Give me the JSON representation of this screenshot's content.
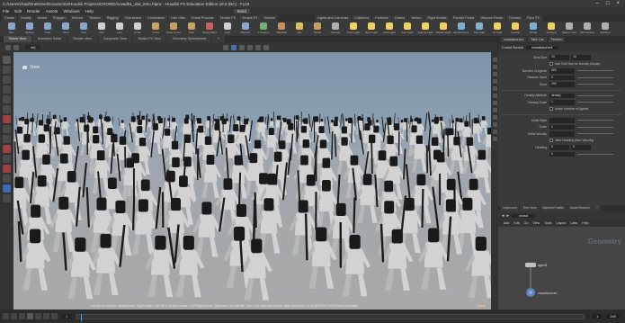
{
  "window": {
    "title": "C:/Users/chad/OneDrive/Documents/Houdini Projects/CROWD/crowd01_sbd_intro.hipnc - Houdini FX Education Edition 18.0 (NC) - Fy18"
  },
  "menu": {
    "items": [
      "File",
      "Edit",
      "Render",
      "Assets",
      "Windows",
      "Help",
      "Help"
    ],
    "desktop": "Build"
  },
  "shelf": {
    "tabs_left": [
      "Create",
      "Modify",
      "Model",
      "Polygon",
      "Deform",
      "Texture",
      "Rigging",
      "Characters",
      "Constraints",
      "Hair Utils",
      "Guide Process",
      "Terrain FX",
      "Simple FX",
      "Volume"
    ],
    "tabs_right": [
      "Lights and Cameras",
      "Collisions",
      "Particles",
      "Grains",
      "Vellum",
      "Rigid Bodies",
      "Particle Fluids",
      "Viscous Fluids",
      "Oceans",
      "Pyro FX"
    ],
    "tools": [
      {
        "label": "Box",
        "color": "#8aa6c8"
      },
      {
        "label": "Sphere",
        "color": "#8aa6c8"
      },
      {
        "label": "Tube",
        "color": "#8aa6c8"
      },
      {
        "label": "Torus",
        "color": "#8aa6c8"
      },
      {
        "label": "Grid",
        "color": "#8aa6c8"
      },
      {
        "label": "Null",
        "color": "#d0d0d0"
      },
      {
        "label": "Line",
        "color": "#d0d0d0"
      },
      {
        "label": "Circle",
        "color": "#d0d0d0"
      },
      {
        "label": "Curve",
        "color": "#c8a060"
      },
      {
        "label": "Draw Curve",
        "color": "#c8a060"
      },
      {
        "label": "Path",
        "color": "#c8a060"
      },
      {
        "label": "Spray Paint",
        "color": "#c86060"
      },
      {
        "label": "Font",
        "color": "#d0d0d0"
      },
      {
        "label": "Platonic",
        "color": "#8aa6c8"
      },
      {
        "label": "L-System",
        "color": "#70b070"
      },
      {
        "label": "Metaball",
        "color": "#c89060"
      },
      {
        "label": "File",
        "color": "#d8c060"
      },
      {
        "label": "Spiral",
        "color": "#c8a060"
      },
      {
        "label": "Camera",
        "color": "#b0b0b0"
      },
      {
        "label": "Point Light",
        "color": "#f0d060"
      },
      {
        "label": "Spot Light",
        "color": "#f0d060"
      },
      {
        "label": "Area Light",
        "color": "#f0d060"
      },
      {
        "label": "Geo Light",
        "color": "#f0d060"
      },
      {
        "label": "Volume Light",
        "color": "#f0d060"
      },
      {
        "label": "Distant Light",
        "color": "#f0d060"
      },
      {
        "label": "Environment",
        "color": "#80b0d0"
      },
      {
        "label": "Sky Light",
        "color": "#80b0d0"
      },
      {
        "label": "GI Light",
        "color": "#f0d060"
      },
      {
        "label": "Caustic",
        "color": "#f0d060"
      },
      {
        "label": "Portal",
        "color": "#80b0d0"
      },
      {
        "label": "Ambient",
        "color": "#f0d060"
      },
      {
        "label": "Stereo Cam",
        "color": "#b0b0b0"
      },
      {
        "label": "VR Camera",
        "color": "#b0b0b0"
      },
      {
        "label": "Switcher",
        "color": "#b0b0b0"
      }
    ]
  },
  "panes": {
    "tabs": [
      "Scene View",
      "Animation Editor",
      "Render View",
      "Composite View",
      "Motion FX View",
      "Geometry Spreadsheet",
      "+"
    ],
    "active": 0
  },
  "viewport": {
    "path": "obj",
    "label": "View",
    "help_text": "Left mouse tumbles. Middle pans. Right dollies. Ctrl+Alt+Left box-zooms. Ctrl+Right zooms. Spacebar-Ctrl-Left tilts. Hold L for alternate tumble, dolly, and zoom. M or Alt+M for First Person Navigation.",
    "camera_label": "Persp",
    "sky_color": "#7e94a8",
    "ground_color": "#a9a9a9"
  },
  "params": {
    "tabs": [
      "crowdsource1",
      "Take List",
      "Perform"
    ],
    "node_type": "Crowd Source",
    "node_name": "crowdsource1",
    "rows": [
      {
        "label": "Area Size",
        "value": "10",
        "value2": "10"
      },
      {
        "label": "",
        "check": true,
        "text": "Use Grid Size for Density Display"
      },
      {
        "label": "Number of Agents",
        "value": "600"
      },
      {
        "label": "Random Seed",
        "value": "0"
      },
      {
        "label": "Timer",
        "value": "200"
      },
      {
        "sep": true
      },
      {
        "label": "Density Attribute",
        "value": "density"
      },
      {
        "label": "Density Scale",
        "value": "1"
      },
      {
        "label": "",
        "check": true,
        "text": "Match Number of Agents"
      },
      {
        "sep": true
      },
      {
        "label": "Initial State",
        "value": ""
      },
      {
        "label": "Scale",
        "value": "1"
      },
      {
        "label": "Initial Velocity",
        "value": ""
      },
      {
        "label": "",
        "check": true,
        "text": "Jitter Heading (Non-Velocity)"
      },
      {
        "label": "Heading",
        "value": "0",
        "value2": "0"
      },
      {
        "label": "",
        "value": "0"
      }
    ]
  },
  "network": {
    "tabs": [
      "/obj/crowd",
      "Tree View",
      "Material Palette",
      "Asset Browser",
      "+"
    ],
    "path": "crowd",
    "menu": [
      "Add",
      "Edit",
      "Go",
      "View",
      "Tools",
      "Layout",
      "Labs",
      "Help"
    ],
    "watermark": "Geometry",
    "nodes": [
      {
        "name": "agent1",
        "color": "#c0c0c0"
      },
      {
        "name": "crowdsource1",
        "color": "#6080c0"
      }
    ]
  },
  "timeline": {
    "frame": "1",
    "start": "1",
    "end": "240"
  }
}
